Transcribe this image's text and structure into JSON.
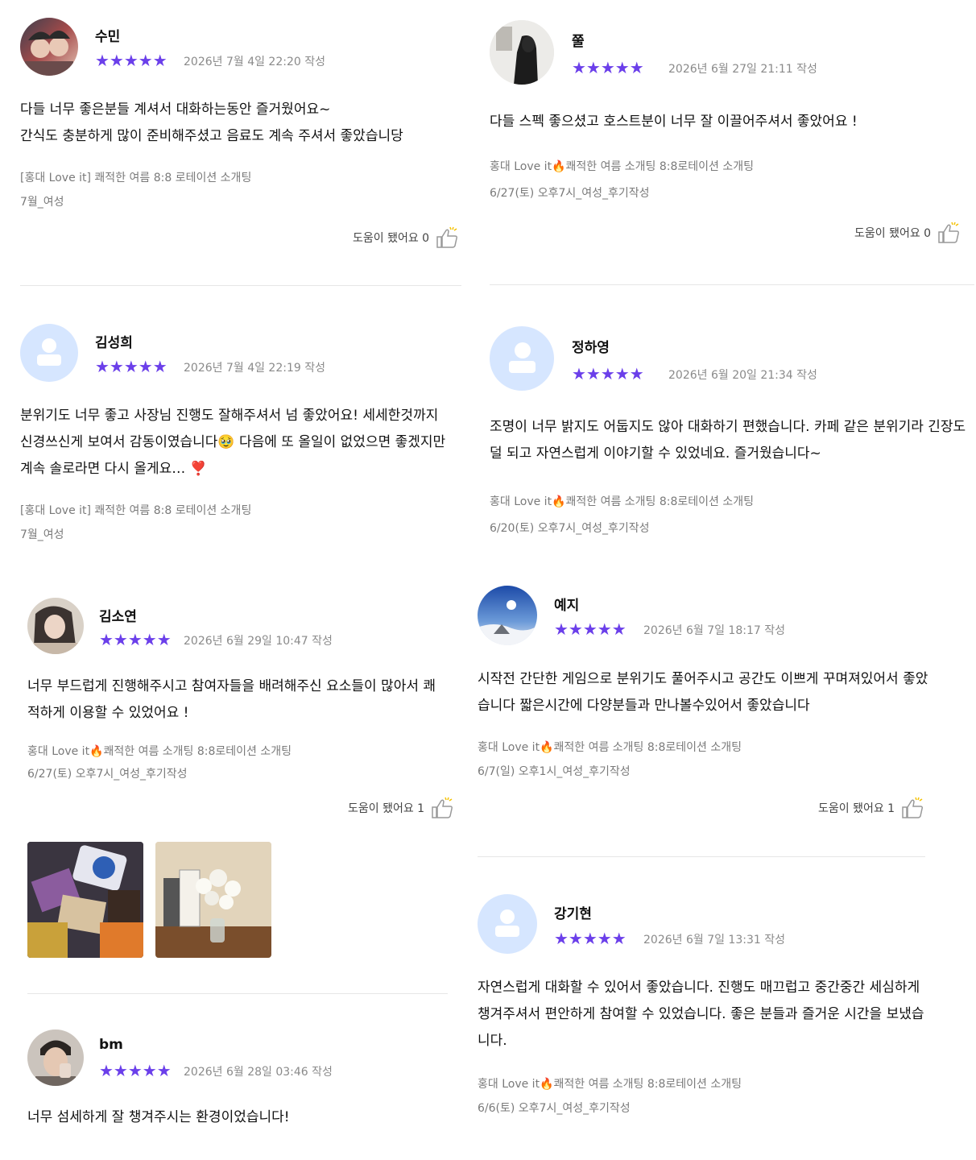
{
  "reviews": {
    "r1": {
      "name": "수민",
      "stars": "★★★★★",
      "date": "2026년 7월 4일 22:20 작성",
      "text": "다들 너무 좋은분들 계셔서 대화하는동안 즐거웠어요~\n간식도 충분하게 많이 준비해주셨고 음료도 계속 주셔서 좋았습니당",
      "meta1": "[홍대 Love it] 쾌적한 여름 8:8 로테이션  소개팅",
      "meta2": "7월_여성",
      "helpful": "도움이 됐어요 0"
    },
    "r2": {
      "name": "쭐",
      "stars": "★★★★★",
      "date": "2026년 6월 27일 21:11 작성",
      "text": "다들 스펙 좋으셨고 호스트분이 너무 잘 이끌어주셔서 좋았어요 !",
      "meta1": "홍대 Love it🔥쾌적한 여름 소개팅 8:8로테이션  소개팅",
      "meta2": "6/27(토) 오후7시_여성_후기작성",
      "helpful": "도움이 됐어요 0"
    },
    "r3": {
      "name": "김성희",
      "stars": "★★★★★",
      "date": "2026년 7월 4일 22:19 작성",
      "text": "분위기도 너무 좋고 사장님 진행도 잘해주셔서 넘 좋았어요! 세세한것까지 신경쓰신게 보여서 감동이였습니다🥹 다음에 또 올일이 없었으면 좋겠지만 계속 솔로라면 다시 올게요… ❣️",
      "meta1": "[홍대 Love it] 쾌적한 여름 8:8 로테이션  소개팅",
      "meta2": "7월_여성"
    },
    "r4": {
      "name": "정하영",
      "stars": "★★★★★",
      "date": "2026년 6월 20일 21:34 작성",
      "text": "조명이 너무 밝지도 어둡지도 않아 대화하기 편했습니다. 카페 같은 분위기라 긴장도 덜 되고 자연스럽게 이야기할 수 있었네요. 즐거웠습니다~",
      "meta1": "홍대 Love it🔥쾌적한 여름 소개팅 8:8로테이션  소개팅",
      "meta2": "6/20(토) 오후7시_여성_후기작성"
    },
    "r5": {
      "name": "김소연",
      "stars": "★★★★★",
      "date": "2026년 6월 29일 10:47 작성",
      "text": "너무 부드럽게 진행해주시고 참여자들을 배려해주신 요소들이 많아서 쾌적하게 이용할 수 있었어요 !",
      "meta1": "홍대 Love it🔥쾌적한 여름 소개팅 8:8로테이션  소개팅",
      "meta2": "6/27(토) 오후7시_여성_후기작성",
      "helpful": "도움이 됐어요 1"
    },
    "r6": {
      "name": "예지",
      "stars": "★★★★★",
      "date": "2026년 6월 7일 18:17 작성",
      "text": "시작전 간단한 게임으로 분위기도 풀어주시고 공간도 이쁘게 꾸며져있어서 좋았습니다 짧은시간에 다양분들과 만나볼수있어서 좋았습니다",
      "meta1": "홍대 Love it🔥쾌적한 여름 소개팅 8:8로테이션  소개팅",
      "meta2": "6/7(일) 오후1시_여성_후기작성",
      "helpful": "도움이 됐어요 1"
    },
    "r7": {
      "name": "강기현",
      "stars": "★★★★★",
      "date": "2026년 6월 7일 13:31 작성",
      "text": "자연스럽게 대화할 수 있어서 좋았습니다. 진행도 매끄럽고 중간중간 세심하게 챙겨주셔서 편안하게 참여할 수 있었습니다. 좋은 분들과 즐거운 시간을 보냈습니다.",
      "meta1": "홍대 Love it🔥쾌적한 여름 소개팅 8:8로테이션  소개팅",
      "meta2": "6/6(토) 오후7시_여성_후기작성"
    },
    "r8": {
      "name": "bm",
      "stars": "★★★★★",
      "date": "2026년 6월 28일 03:46 작성",
      "text": "너무 섬세하게 잘 챙겨주시는 환경이었습니다!"
    }
  }
}
